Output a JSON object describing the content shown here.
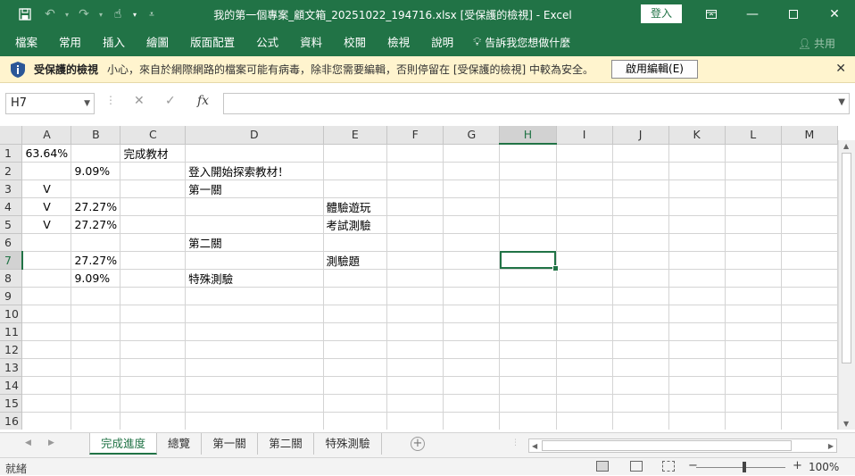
{
  "titlebar": {
    "title": "我的第一個專案_顧文箱_20251022_194716.xlsx  [受保護的檢視]  -  Excel",
    "login_label": "登入"
  },
  "ribbon": {
    "tabs": [
      "檔案",
      "常用",
      "插入",
      "繪圖",
      "版面配置",
      "公式",
      "資料",
      "校閱",
      "檢視",
      "說明"
    ],
    "tellme": "告訴我您想做什麼",
    "share": "共用"
  },
  "message_bar": {
    "title": "受保護的檢視",
    "text": "小心，來自於網際網路的檔案可能有病毒，除非您需要編輯，否則停留在 [受保護的檢視] 中較為安全。",
    "enable_button": "啟用編輯(E)"
  },
  "formula_bar": {
    "name_box": "H7",
    "fx_label": "fx",
    "formula": ""
  },
  "grid": {
    "columns": [
      "A",
      "B",
      "C",
      "D",
      "E",
      "F",
      "G",
      "H",
      "I",
      "J",
      "K",
      "L",
      "M"
    ],
    "selected_column": "H",
    "selected_row": 7,
    "rows": [
      {
        "n": "1",
        "cells": [
          "63.64%",
          "",
          "完成教材",
          "",
          "",
          "",
          "",
          "",
          "",
          "",
          "",
          "",
          ""
        ]
      },
      {
        "n": "2",
        "cells": [
          "",
          "9.09%",
          "",
          "登入開始探索教材！",
          "",
          "",
          "",
          "",
          "",
          "",
          "",
          "",
          ""
        ]
      },
      {
        "n": "3",
        "cells": [
          "V",
          "",
          "",
          "第一關",
          "",
          "",
          "",
          "",
          "",
          "",
          "",
          "",
          ""
        ]
      },
      {
        "n": "4",
        "cells": [
          "V",
          "27.27%",
          "",
          "",
          "體驗遊玩",
          "",
          "",
          "",
          "",
          "",
          "",
          "",
          ""
        ]
      },
      {
        "n": "5",
        "cells": [
          "V",
          "27.27%",
          "",
          "",
          "考試測驗",
          "",
          "",
          "",
          "",
          "",
          "",
          "",
          ""
        ]
      },
      {
        "n": "6",
        "cells": [
          "",
          "",
          "",
          "第二關",
          "",
          "",
          "",
          "",
          "",
          "",
          "",
          "",
          ""
        ]
      },
      {
        "n": "7",
        "cells": [
          "",
          "27.27%",
          "",
          "",
          "測驗題",
          "",
          "",
          "",
          "",
          "",
          "",
          "",
          ""
        ]
      },
      {
        "n": "8",
        "cells": [
          "",
          "9.09%",
          "",
          "特殊測驗",
          "",
          "",
          "",
          "",
          "",
          "",
          "",
          "",
          ""
        ]
      },
      {
        "n": "9",
        "cells": [
          "",
          "",
          "",
          "",
          "",
          "",
          "",
          "",
          "",
          "",
          "",
          "",
          ""
        ]
      },
      {
        "n": "10",
        "cells": [
          "",
          "",
          "",
          "",
          "",
          "",
          "",
          "",
          "",
          "",
          "",
          "",
          ""
        ]
      },
      {
        "n": "11",
        "cells": [
          "",
          "",
          "",
          "",
          "",
          "",
          "",
          "",
          "",
          "",
          "",
          "",
          ""
        ]
      },
      {
        "n": "12",
        "cells": [
          "",
          "",
          "",
          "",
          "",
          "",
          "",
          "",
          "",
          "",
          "",
          "",
          ""
        ]
      },
      {
        "n": "13",
        "cells": [
          "",
          "",
          "",
          "",
          "",
          "",
          "",
          "",
          "",
          "",
          "",
          "",
          ""
        ]
      },
      {
        "n": "14",
        "cells": [
          "",
          "",
          "",
          "",
          "",
          "",
          "",
          "",
          "",
          "",
          "",
          "",
          ""
        ]
      },
      {
        "n": "15",
        "cells": [
          "",
          "",
          "",
          "",
          "",
          "",
          "",
          "",
          "",
          "",
          "",
          "",
          ""
        ]
      },
      {
        "n": "16",
        "cells": [
          "",
          "",
          "",
          "",
          "",
          "",
          "",
          "",
          "",
          "",
          "",
          "",
          ""
        ]
      }
    ]
  },
  "sheets": {
    "tabs": [
      "完成進度",
      "總覽",
      "第一關",
      "第二關",
      "特殊測驗"
    ],
    "active": 0
  },
  "status": {
    "text": "就緒",
    "zoom": "100%"
  },
  "colors": {
    "accent": "#217346",
    "message_bar": "#fff4ce"
  }
}
